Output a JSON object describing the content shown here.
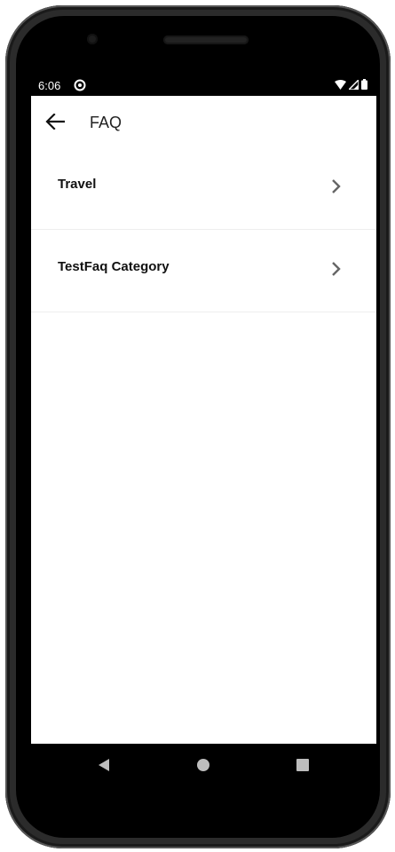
{
  "status_bar": {
    "time": "6:06",
    "app_icon": "at-sign-icon",
    "icons": [
      "wifi-icon",
      "signal-icon",
      "battery-icon"
    ]
  },
  "app_bar": {
    "title": "FAQ",
    "back_icon": "arrow-left-icon"
  },
  "faq_categories": [
    {
      "label": "Travel",
      "icon": "chevron-right-icon"
    },
    {
      "label": "TestFaq Category",
      "icon": "chevron-right-icon"
    }
  ],
  "nav_bar": {
    "buttons": [
      "back-triangle-icon",
      "home-circle-icon",
      "recents-square-icon"
    ]
  },
  "colors": {
    "status_bar_bg": "#000000",
    "screen_bg": "#ffffff",
    "chevron": "#666666",
    "divider": "#eeeeee"
  }
}
